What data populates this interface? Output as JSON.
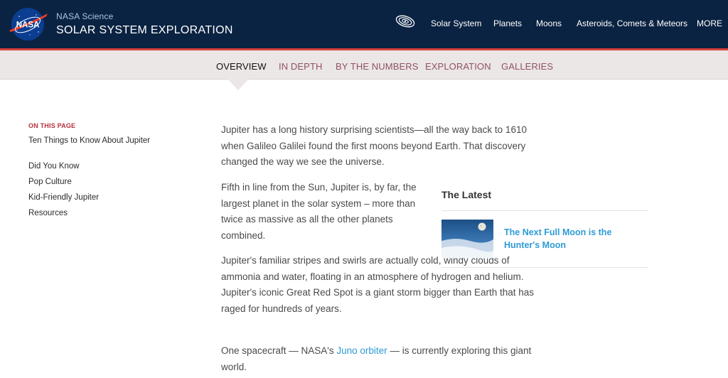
{
  "header": {
    "logo_text": "NASA",
    "site_kicker": "NASA Science",
    "site_title": "SOLAR SYSTEM EXPLORATION",
    "nav_icon": "solar-system-orbit-icon",
    "nav": [
      "Solar System",
      "Planets",
      "Moons",
      "Asteroids, Comets & Meteors",
      "MORE"
    ]
  },
  "subnav": {
    "tabs": [
      "OVERVIEW",
      "IN DEPTH",
      "BY THE NUMBERS",
      "EXPLORATION",
      "GALLERIES"
    ],
    "active_index": 0
  },
  "sidebar": {
    "heading": "ON THIS PAGE",
    "items": [
      "Ten Things to Know About Jupiter",
      "Did You Know",
      "Pop Culture",
      "Kid-Friendly Jupiter",
      "Resources"
    ]
  },
  "article": {
    "p1": "Jupiter has a long history surprising scientists—all the way back to 1610 when Galileo Galilei found the first moons beyond Earth. That discovery changed the way we see the universe.",
    "p2": "Fifth in line from the Sun, Jupiter is, by far, the largest planet in the solar system – more than twice as massive as all the other planets combined.",
    "p3": "Jupiter's familiar stripes and swirls are actually cold, windy clouds of ammonia and water, floating in an atmosphere of hydrogen and helium. Jupiter's iconic Great Red Spot is a giant storm bigger than Earth that has raged for hundreds of years.",
    "p4_before": "One spacecraft — NASA's ",
    "p4_link": "Juno orbiter",
    "p4_after": " — is currently exploring this giant world."
  },
  "latest": {
    "heading": "The Latest",
    "item_title": "The Next Full Moon is the Hunter's Moon"
  },
  "colors": {
    "header_bg": "#0b2342",
    "accent_red": "#d9423d",
    "subnav_bg": "#ebe7e6",
    "subnav_text": "#915263",
    "link_blue": "#2e9bd6"
  }
}
